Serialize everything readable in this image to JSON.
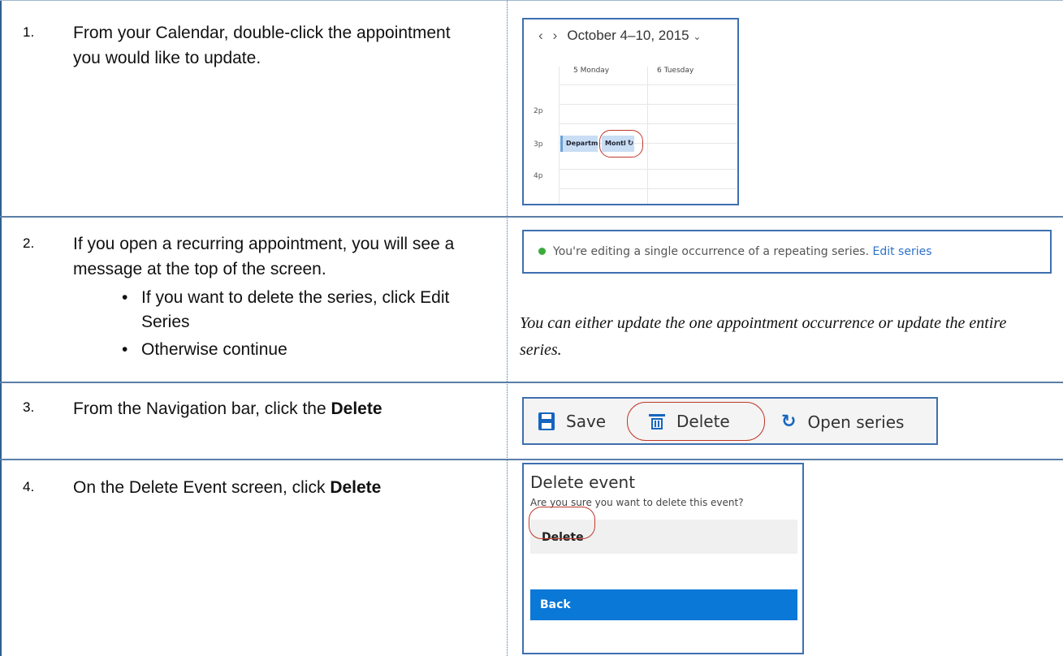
{
  "steps": [
    {
      "number": "1.",
      "text": "From your Calendar, double-click the appointment you would like to update."
    },
    {
      "number": "2.",
      "text": "If you open a recurring appointment, you will see a message at the top of the screen.",
      "bullets": [
        "If you want to delete the series, click Edit Series",
        "Otherwise continue"
      ]
    },
    {
      "number": "3.",
      "text_prefix": "From the Navigation bar, click the ",
      "text_bold": "Delete"
    },
    {
      "number": "4.",
      "text_prefix": "On the Delete Event screen, click ",
      "text_bold": "Delete"
    }
  ],
  "calendar": {
    "range_title": "October 4–10, 2015",
    "prev_icon": "chevron-left-icon",
    "next_icon": "chevron-right-icon",
    "caret_icon": "chevron-down-icon",
    "days": [
      "5 Monday",
      "6 Tuesday"
    ],
    "times": [
      "2p",
      "3p",
      "4p"
    ],
    "events": [
      "Departm",
      "Montl"
    ],
    "recurring_icon": "sync-icon"
  },
  "series_banner": {
    "message": "You're editing a single occurrence of a repeating series.",
    "link": "Edit series",
    "status_color": "#3bab3c",
    "link_color": "#2d72c8"
  },
  "note": "You can either update the one appointment occurrence or update the entire series.",
  "toolbar": {
    "save_label": "Save",
    "delete_label": "Delete",
    "open_series_label": "Open series",
    "icon_color": "#1565c0"
  },
  "delete_dialog": {
    "title": "Delete event",
    "question": "Are you sure you want to delete this event?",
    "delete_label": "Delete",
    "back_label": "Back",
    "back_color": "#0a78d7"
  }
}
